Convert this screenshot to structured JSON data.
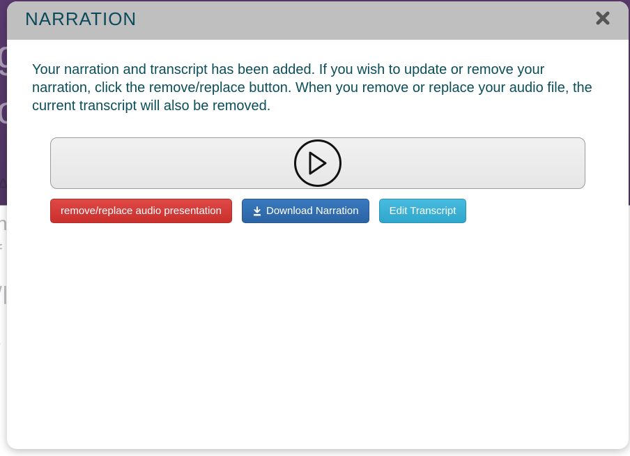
{
  "modal": {
    "title": "NARRATION",
    "description": "Your narration and transcript has been added. If you wish to update or remove your narration, click the remove/replace button. When you remove or replace your audio file, the current transcript will also be removed."
  },
  "player": {
    "play_label": "Play"
  },
  "buttons": {
    "remove_replace": "remove/replace audio presentation",
    "download_narration": "Download Narration",
    "edit_transcript": "Edit Transcript"
  },
  "background": {
    "g": "g",
    "o": "o",
    "au": "AU",
    "h": "h",
    "f": "f",
    "vl": "/|",
    "dot1": ".",
    "dot2": "."
  }
}
